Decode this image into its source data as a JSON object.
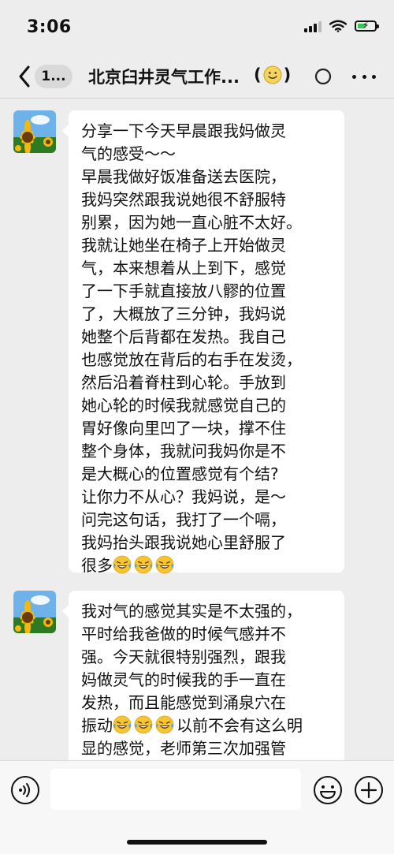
{
  "status": {
    "time": "3:06"
  },
  "nav": {
    "badge": "1...",
    "title": "北京臼井灵气工作...",
    "title_paren_open": "(",
    "title_paren_close": ")"
  },
  "messages": [
    {
      "lines": [
        "分享一下今天早晨跟我妈做灵",
        "气的感受～～",
        "早晨我做好饭准备送去医院，",
        "我妈突然跟我说她很不舒服特",
        "别累，因为她一直心脏不太好。",
        "我就让她坐在椅子上开始做灵",
        "气，本来想着从上到下，感觉",
        "了一下手就直接放八髎的位置",
        "了，大概放了三分钟，我妈说",
        "她整个后背都在发热。我自己",
        "也感觉放在背后的右手在发烫，",
        "然后沿着脊柱到心轮。手放到",
        "她心轮的时候我就感觉自己的",
        "胃好像向里凹了一块，撑不住",
        "整个身体，我就问我妈你是不",
        "是大概心的位置感觉有个结?",
        "让你力不从心？我妈说，是～",
        "问完这句话，我打了一个嗝，",
        "我妈抬头跟我说她心里舒服了"
      ],
      "last_line_text": "很多",
      "emoji": "laugh-cry-emoji",
      "emoji_count": 3
    },
    {
      "lines": [
        "我对气的感觉其实是不太强的，",
        "平时给我爸做的时候气感并不",
        "强。今天就很特别强烈，跟我",
        "妈做灵气的时候我的手一直在",
        "发热，而且能感觉到涌泉穴在"
      ],
      "emoji_line_before": "振动",
      "emoji_line_after": "以前不会有这么明",
      "next_line": "显的感觉，老师第三次加强管",
      "emoji": "laugh-cry-emoji",
      "emoji_count": 3
    }
  ],
  "input": {
    "value": "",
    "placeholder": ""
  },
  "colors": {
    "background": "#ededed",
    "bubble": "#ffffff",
    "emoji_face": "#f7c531",
    "battery": "#34c759"
  }
}
